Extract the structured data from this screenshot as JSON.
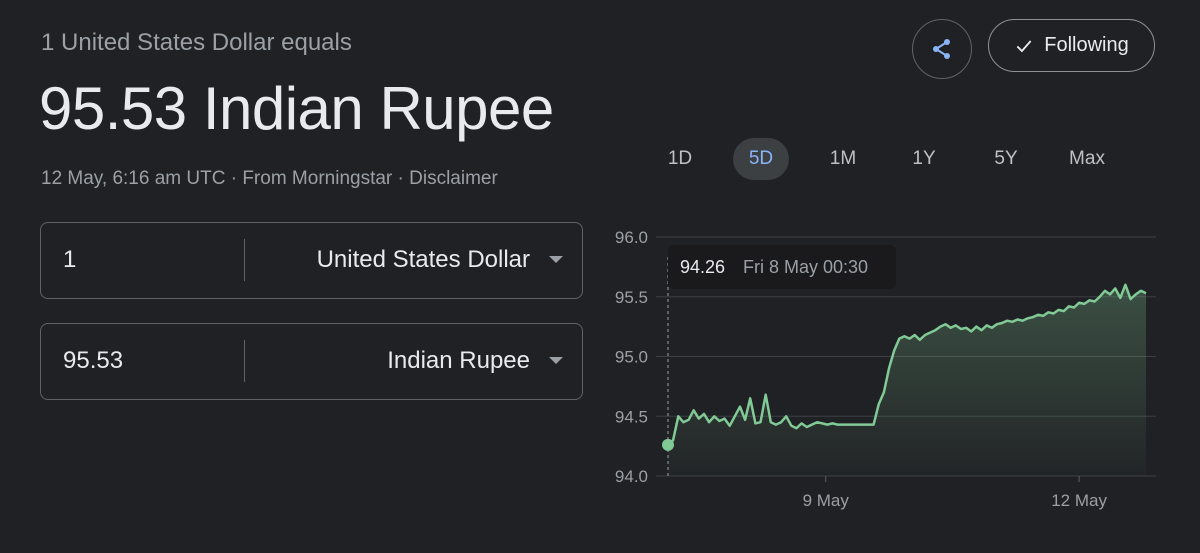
{
  "header": {
    "subtitle": "1 United States Dollar equals",
    "rate": "95.53 Indian Rupee",
    "timestamp": "12 May, 6:16 am UTC",
    "source": "From Morningstar",
    "disclaimer": "Disclaimer",
    "separator": " · "
  },
  "actions": {
    "share_icon": "share-icon",
    "follow_label": "Following",
    "follow_icon": "check-icon"
  },
  "converter": {
    "from": {
      "amount": "1",
      "currency": "United States Dollar"
    },
    "to": {
      "amount": "95.53",
      "currency": "Indian Rupee"
    }
  },
  "ranges": {
    "items": [
      "1D",
      "5D",
      "1M",
      "1Y",
      "5Y",
      "Max"
    ],
    "selected": "5D"
  },
  "tooltip": {
    "value": "94.26",
    "label": "Fri 8 May 00:30"
  },
  "colors": {
    "background": "#202124",
    "line": "#81c995",
    "accent": "#8ab4f8",
    "grid": "#3c4043"
  },
  "chart_data": {
    "type": "area",
    "title": "",
    "xlabel": "",
    "ylabel": "",
    "ylim": [
      94.0,
      96.0
    ],
    "yticks": [
      "96.0",
      "95.5",
      "95.0",
      "94.5",
      "94.0"
    ],
    "xticks": [
      "9 May",
      "12 May"
    ],
    "grid": true,
    "x_tick_positions": [
      0.33,
      0.86
    ],
    "values": [
      94.26,
      94.3,
      94.5,
      94.45,
      94.47,
      94.55,
      94.48,
      94.52,
      94.45,
      94.5,
      94.46,
      94.48,
      94.42,
      94.5,
      94.58,
      94.47,
      94.65,
      94.44,
      94.45,
      94.68,
      94.45,
      94.43,
      94.45,
      94.5,
      94.42,
      94.4,
      94.44,
      94.41,
      94.43,
      94.45,
      94.44,
      94.43,
      94.44,
      94.43,
      94.43,
      94.43,
      94.43,
      94.43,
      94.43,
      94.43,
      94.43,
      94.6,
      94.7,
      94.9,
      95.05,
      95.15,
      95.17,
      95.15,
      95.18,
      95.14,
      95.18,
      95.2,
      95.22,
      95.25,
      95.27,
      95.24,
      95.26,
      95.23,
      95.24,
      95.21,
      95.25,
      95.22,
      95.26,
      95.24,
      95.27,
      95.28,
      95.3,
      95.29,
      95.31,
      95.3,
      95.32,
      95.33,
      95.35,
      95.34,
      95.37,
      95.36,
      95.39,
      95.38,
      95.42,
      95.41,
      95.45,
      95.44,
      95.47,
      95.46,
      95.5,
      95.55,
      95.52,
      95.57,
      95.49,
      95.6,
      95.48,
      95.52,
      95.55,
      95.53
    ],
    "marker_index": 0
  }
}
